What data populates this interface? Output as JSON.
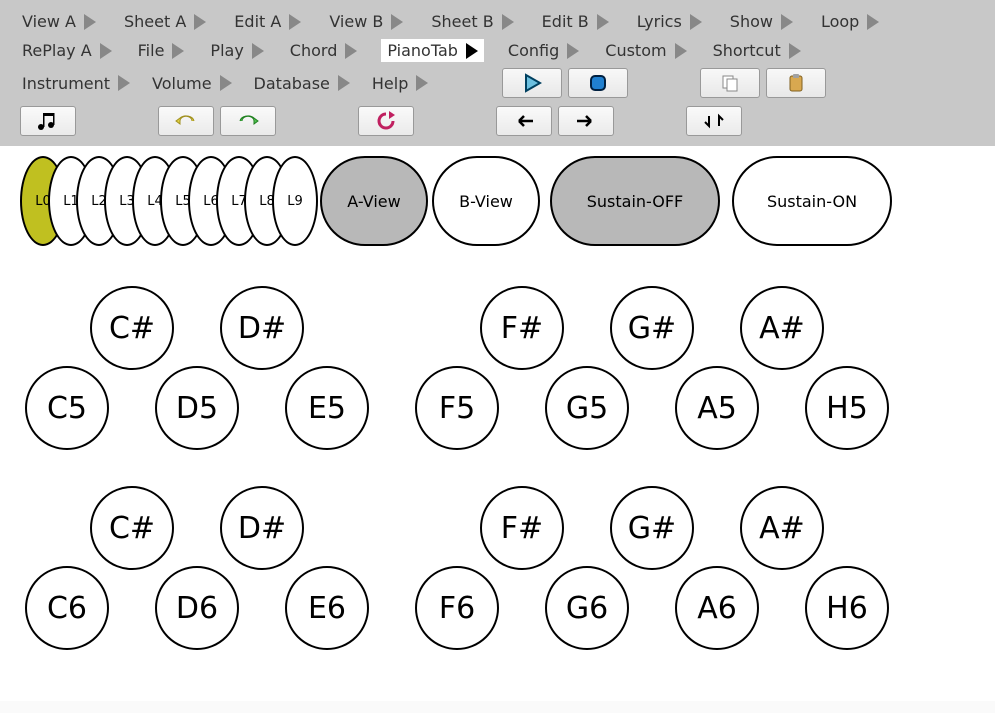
{
  "menu": {
    "row1": [
      "View A",
      "Sheet A",
      "Edit A",
      "View B",
      "Sheet B",
      "Edit B",
      "Lyrics",
      "Show",
      "Loop"
    ],
    "row2": [
      "RePlay A",
      "File",
      "Play",
      "Chord",
      "PianoTab",
      "Config",
      "Custom",
      "Shortcut"
    ],
    "row3": [
      "Instrument",
      "Volume",
      "Database",
      "Help"
    ],
    "active": "PianoTab"
  },
  "ovals": {
    "layers": [
      "L0",
      "L1",
      "L2",
      "L3",
      "L4",
      "L5",
      "L6",
      "L7",
      "L8",
      "L9"
    ],
    "selected": "L0",
    "aview": "A-View",
    "bview": "B-View",
    "sustain_off": "Sustain-OFF",
    "sustain_on": "Sustain-ON"
  },
  "keys": {
    "oct5": {
      "sharps": [
        "C#",
        "D#",
        "F#",
        "G#",
        "A#"
      ],
      "whites": [
        "C5",
        "D5",
        "E5",
        "F5",
        "G5",
        "A5",
        "H5"
      ]
    },
    "oct6": {
      "sharps": [
        "C#",
        "D#",
        "F#",
        "G#",
        "A#"
      ],
      "whites": [
        "C6",
        "D6",
        "E6",
        "F6",
        "G6",
        "A6",
        "H6"
      ]
    }
  }
}
